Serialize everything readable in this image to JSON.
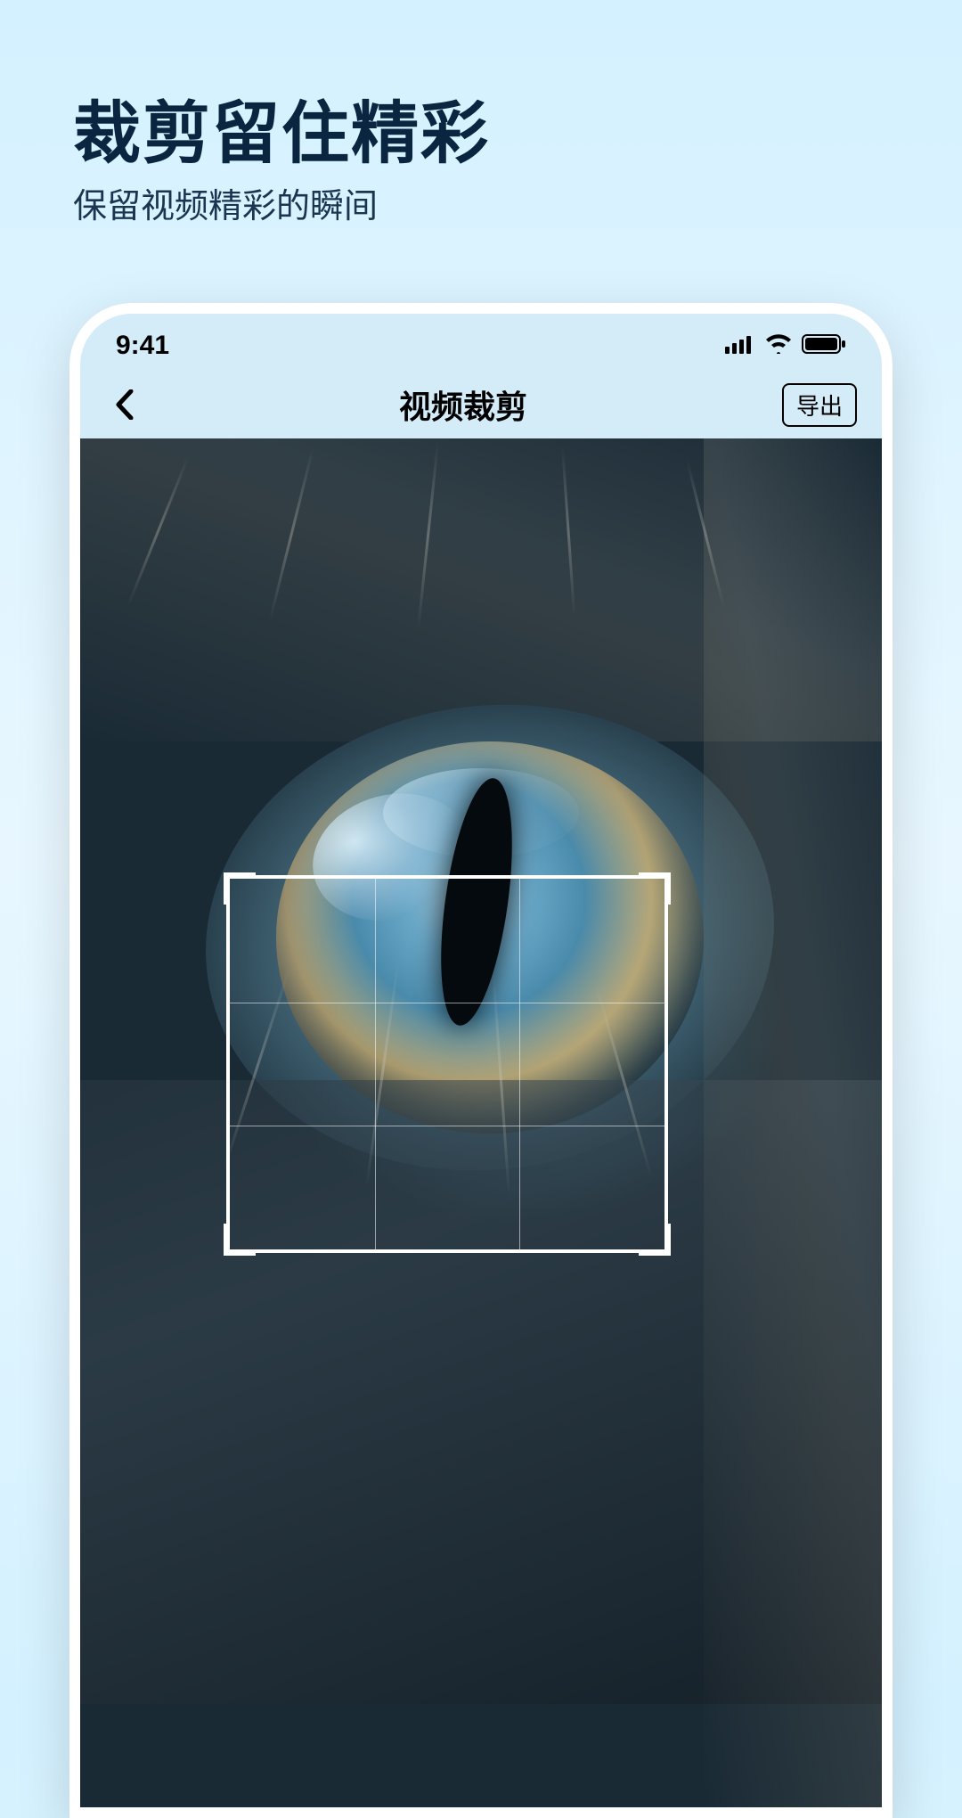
{
  "promo": {
    "title": "裁剪留住精彩",
    "subtitle": "保留视频精彩的瞬间"
  },
  "status": {
    "time": "9:41"
  },
  "nav": {
    "title": "视频裁剪",
    "export_label": "导出"
  }
}
